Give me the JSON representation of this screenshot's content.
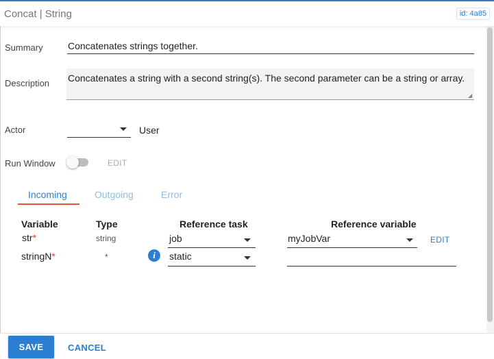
{
  "header": {
    "title": "Concat | String",
    "id_badge": "id: 4a85"
  },
  "form": {
    "summary_label": "Summary",
    "summary_value": "Concatenates strings together.",
    "description_label": "Description",
    "description_value": "Concatenates a string with a second string(s). The second parameter can be a string or array.",
    "actor_label": "Actor",
    "actor_value": "",
    "actor_suffix": "User",
    "run_window_label": "Run Window",
    "run_window_enabled": false,
    "run_window_edit": "EDIT"
  },
  "tabs": [
    {
      "label": "Incoming",
      "active": true
    },
    {
      "label": "Outgoing",
      "active": false
    },
    {
      "label": "Error",
      "active": false
    }
  ],
  "table": {
    "headers": {
      "variable": "Variable",
      "type": "Type",
      "reference_task": "Reference task",
      "reference_variable": "Reference variable"
    },
    "rows": [
      {
        "variable": "str",
        "required_mark": "*",
        "type": "string",
        "reference_task": "job",
        "reference_variable": "myJobVar",
        "edit": "EDIT"
      },
      {
        "variable": "stringN",
        "required_mark": "*",
        "type": "*",
        "reference_task": "static",
        "reference_variable": "",
        "info_icon": "i"
      }
    ]
  },
  "footer": {
    "save_label": "SAVE",
    "cancel_label": "CANCEL"
  },
  "colors": {
    "accent": "#2c7fd0",
    "tab_underline": "#e2563a",
    "required": "#e53935"
  }
}
